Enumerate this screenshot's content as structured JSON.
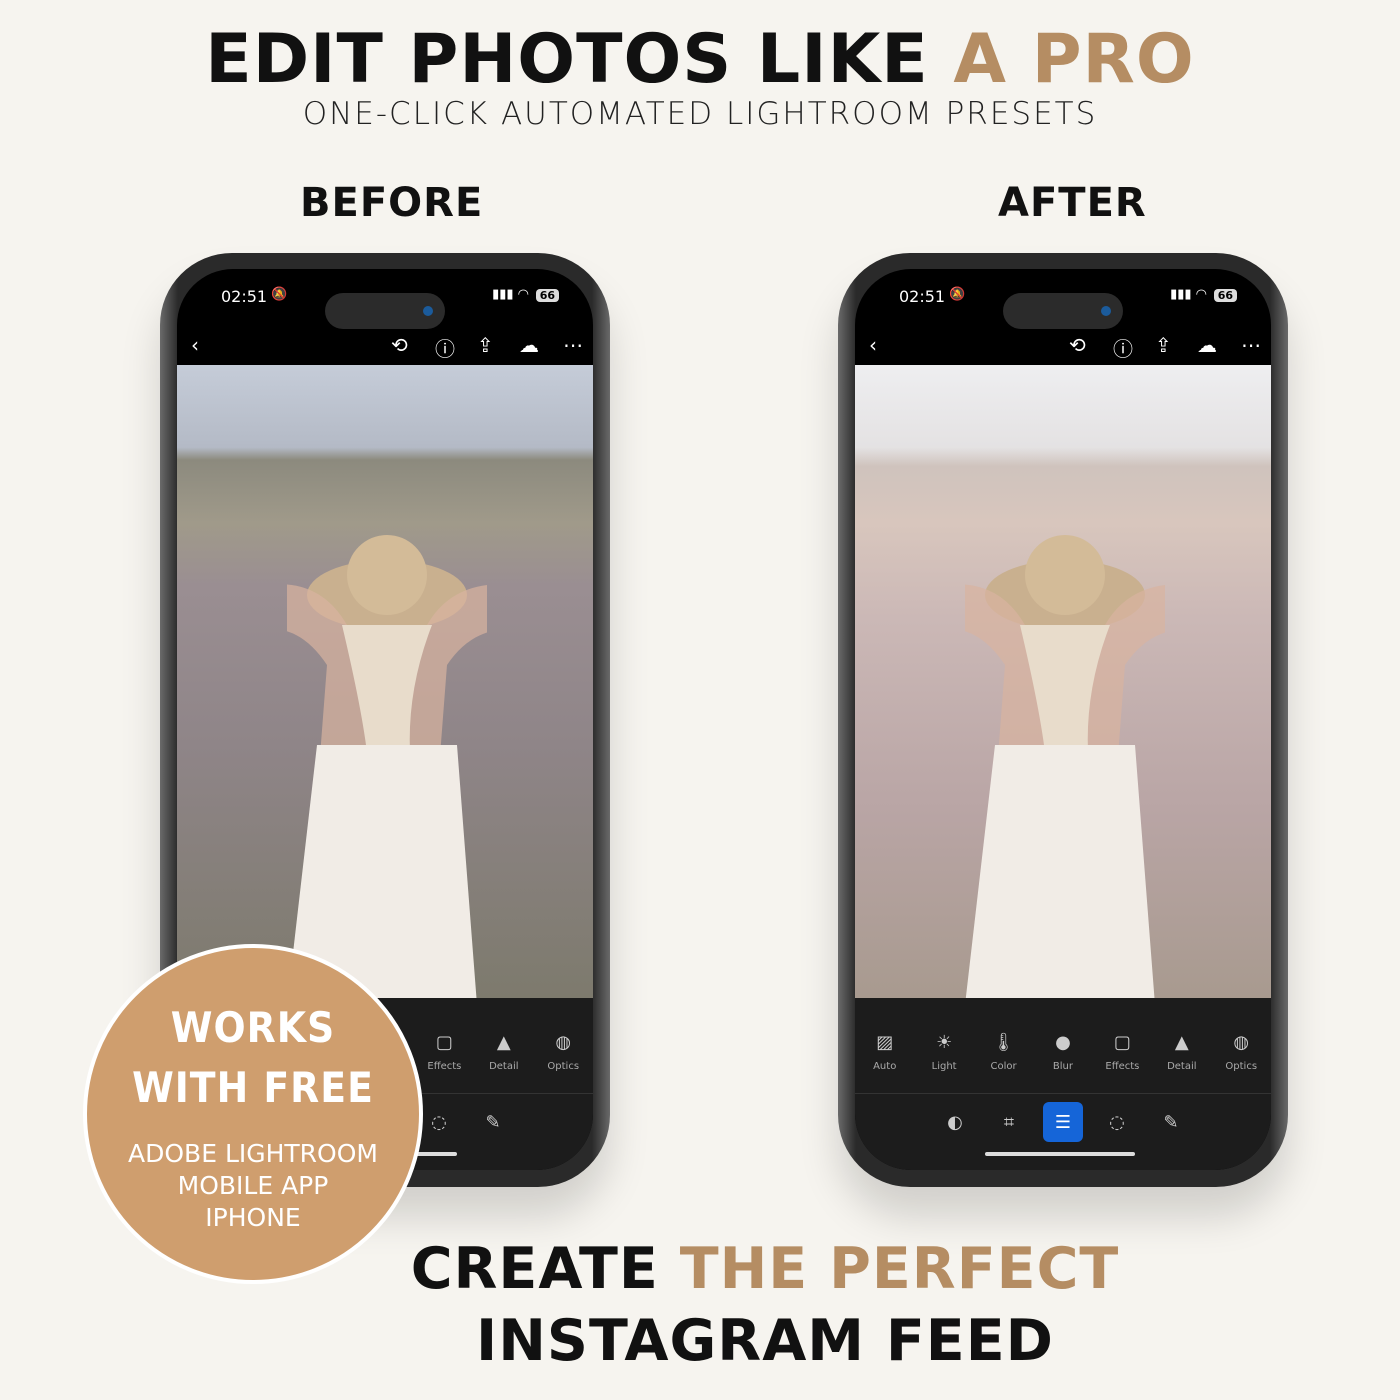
{
  "header": {
    "title_main": "EDIT PHOTOS LIKE ",
    "title_accent": "A PRO",
    "subtitle": "ONE-CLICK AUTOMATED LIGHTROOM PRESETS"
  },
  "labels": {
    "before": "BEFORE",
    "after": "AFTER"
  },
  "phone": {
    "time": "02:51",
    "battery": "66",
    "tools": [
      {
        "label": "Auto",
        "icon": "auto-icon",
        "glyph": "▨"
      },
      {
        "label": "Light",
        "icon": "sun-icon",
        "glyph": "☀"
      },
      {
        "label": "Color",
        "icon": "thermometer-icon",
        "glyph": "🌡"
      },
      {
        "label": "Blur",
        "icon": "drop-icon",
        "glyph": "●"
      },
      {
        "label": "Effects",
        "icon": "effects-icon",
        "glyph": "▢"
      },
      {
        "label": "Detail",
        "icon": "triangle-icon",
        "glyph": "▲"
      },
      {
        "label": "Optics",
        "icon": "lens-icon",
        "glyph": "◍"
      }
    ],
    "modes": [
      {
        "icon": "presets-icon",
        "glyph": "◐"
      },
      {
        "icon": "crop-icon",
        "glyph": "⌗"
      },
      {
        "icon": "edit-sliders-icon",
        "glyph": "☰",
        "active": true
      },
      {
        "icon": "masking-icon",
        "glyph": "◌"
      },
      {
        "icon": "healing-icon",
        "glyph": "✎"
      }
    ]
  },
  "badge": {
    "line1": "WORKS",
    "line2": "WITH FREE",
    "line3": "ADOBE LIGHTROOM",
    "line4": "MOBILE APP",
    "line5": "IPHONE"
  },
  "footer": {
    "line1_a": "CREATE ",
    "line1_b": "THE PERFECT",
    "line2": "INSTAGRAM FEED"
  },
  "colors": {
    "accent": "#b58d63",
    "badge": "#cf9e6e",
    "active_tool": "#1565d8",
    "background": "#f6f4ef"
  }
}
